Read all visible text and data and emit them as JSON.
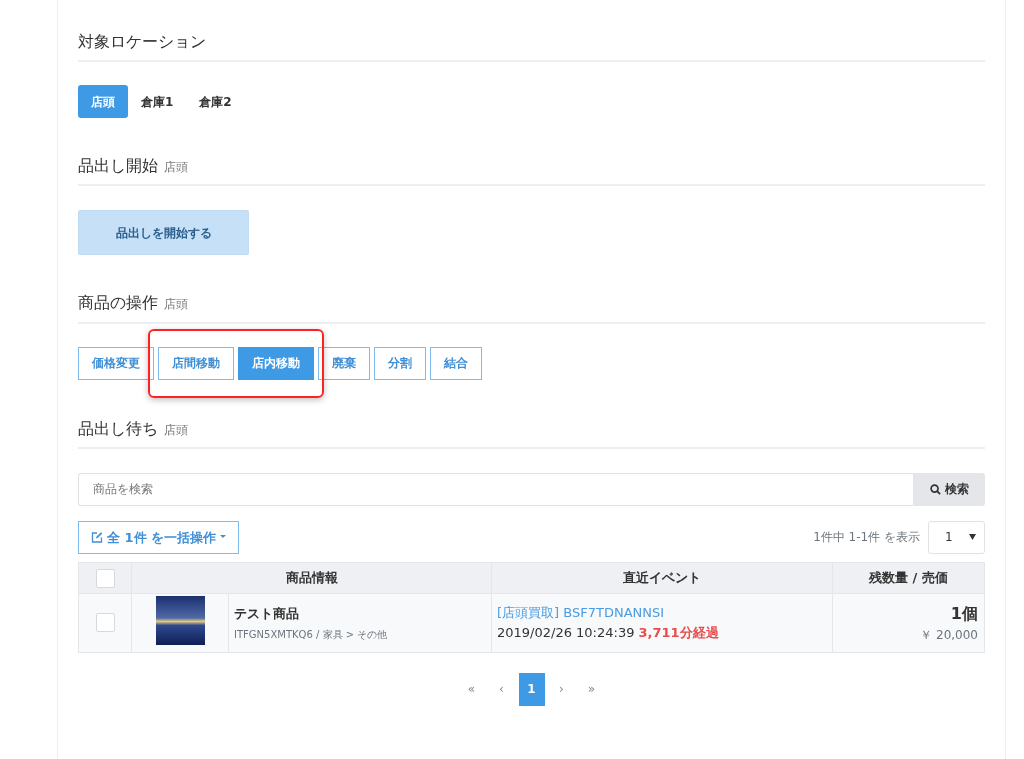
{
  "location": {
    "title": "対象ロケーション",
    "tabs": [
      {
        "label": "店頭",
        "selected": true
      },
      {
        "label": "倉庫1",
        "selected": false
      },
      {
        "label": "倉庫2",
        "selected": false
      }
    ]
  },
  "start": {
    "title": "品出し開始",
    "location": "店頭",
    "button": "品出しを開始する"
  },
  "operations": {
    "title": "商品の操作",
    "location": "店頭",
    "buttons": [
      {
        "label": "価格変更",
        "selected": false,
        "highlighted": false
      },
      {
        "label": "店間移動",
        "selected": false,
        "highlighted": true
      },
      {
        "label": "店内移動",
        "selected": true,
        "highlighted": true
      },
      {
        "label": "廃棄",
        "selected": false,
        "highlighted": false
      },
      {
        "label": "分割",
        "selected": false,
        "highlighted": false
      },
      {
        "label": "結合",
        "selected": false,
        "highlighted": false
      }
    ]
  },
  "waiting": {
    "title": "品出し待ち",
    "location": "店頭",
    "search": {
      "placeholder": "商品を検索",
      "button": "検索"
    },
    "bulk_button": "全 1件 を一括操作",
    "count": "1件中 1-1件 を表示",
    "page_size": "1",
    "table": {
      "header_checked": false,
      "columns": [
        "商品情報",
        "直近イベント",
        "残数量 / 売価"
      ],
      "rows": [
        {
          "checked": false,
          "name": "テスト商品",
          "detail": "ITFGN5XMTKQ6 / 家具 > その他",
          "event": "[店頭買取] BSF7TDNANNSI",
          "time": "2019/02/26 10:24:39",
          "elapsed": "3,711分経過",
          "quantity": "1個",
          "price": "￥ 20,000"
        }
      ]
    },
    "pagination": [
      {
        "label": "«",
        "selected": false
      },
      {
        "label": "‹",
        "selected": false
      },
      {
        "label": "1",
        "selected": true
      },
      {
        "label": "›",
        "selected": false
      },
      {
        "label": "»",
        "selected": false
      }
    ]
  }
}
